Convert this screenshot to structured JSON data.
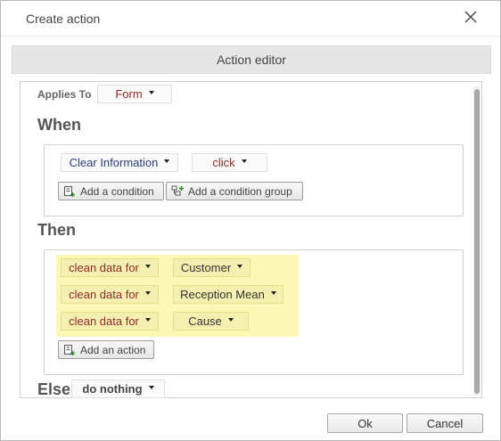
{
  "dialog": {
    "title": "Create action",
    "tab_label": "Action editor"
  },
  "applies_to": {
    "label": "Applies To",
    "value": "Form"
  },
  "when": {
    "heading": "When",
    "element": "Clear Information",
    "event": "click",
    "add_condition": "Add a condition",
    "add_condition_group": "Add a condition group"
  },
  "then": {
    "heading": "Then",
    "actions": [
      {
        "action": "clean data for",
        "target": "Customer"
      },
      {
        "action": "clean data for",
        "target": "Reception Mean"
      },
      {
        "action": "clean data for",
        "target": "Cause"
      }
    ],
    "add_action": "Add an action"
  },
  "else": {
    "heading": "Else",
    "value": "do nothing"
  },
  "footer": {
    "ok": "Ok",
    "cancel": "Cancel"
  },
  "icons": [
    "close-icon",
    "add-condition-icon",
    "add-condition-group-icon",
    "add-action-icon",
    "caret-down-icon"
  ],
  "colors": {
    "highlight": "#fbf8b6",
    "red_text": "#8b2b2b",
    "blue_text": "#2c3e7a"
  }
}
